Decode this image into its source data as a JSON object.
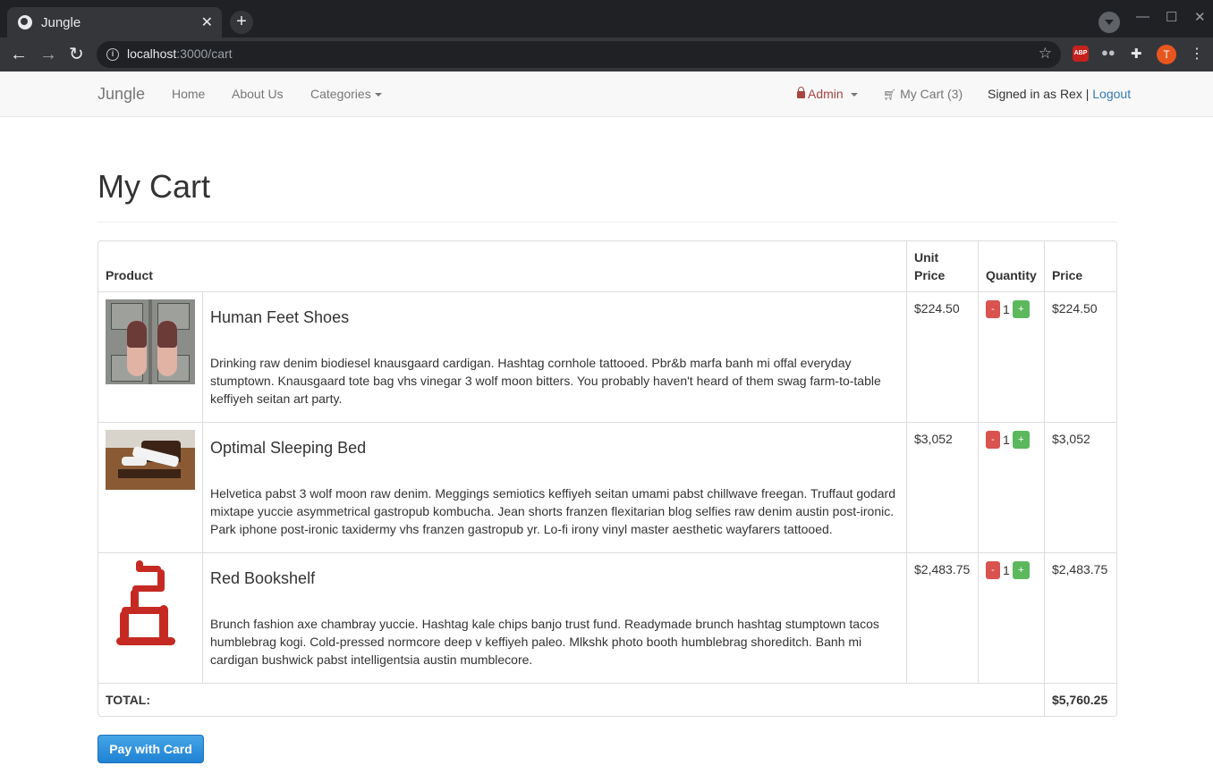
{
  "browser": {
    "tab_title": "Jungle",
    "tab_close": "✕",
    "new_tab": "+",
    "url_host": "localhost",
    "url_path": ":3000/cart",
    "abp_label": "ABP",
    "avatar_letter": "T"
  },
  "nav": {
    "brand": "Jungle",
    "home": "Home",
    "about": "About Us",
    "categories": "Categories",
    "admin": "Admin",
    "cart": "My Cart (3)",
    "signed_in": "Signed in as Rex",
    "separator": "|",
    "logout": "Logout"
  },
  "page": {
    "title": "My Cart"
  },
  "table": {
    "headers": {
      "product": "Product",
      "unit_price": "Unit Price",
      "quantity": "Quantity",
      "price": "Price"
    },
    "rows": [
      {
        "name": "Human Feet Shoes",
        "description": "Drinking raw denim biodiesel knausgaard cardigan. Hashtag cornhole tattooed. Pbr&b marfa banh mi offal everyday stumptown. Knausgaard tote bag vhs vinegar 3 wolf moon bitters. You probably haven't heard of them swag farm-to-table keffiyeh seitan art party.",
        "unit_price": "$224.50",
        "quantity": "1",
        "price": "$224.50"
      },
      {
        "name": "Optimal Sleeping Bed",
        "description": "Helvetica pabst 3 wolf moon raw denim. Meggings semiotics keffiyeh seitan umami pabst chillwave freegan. Truffaut godard mixtape yuccie asymmetrical gastropub kombucha. Jean shorts franzen flexitarian blog selfies raw denim austin post-ironic. Park iphone post-ironic taxidermy vhs franzen gastropub yr. Lo-fi irony vinyl master aesthetic wayfarers tattooed.",
        "unit_price": "$3,052",
        "quantity": "1",
        "price": "$3,052"
      },
      {
        "name": "Red Bookshelf",
        "description": "Brunch fashion axe chambray yuccie. Hashtag kale chips banjo trust fund. Readymade brunch hashtag stumptown tacos humblebrag kogi. Cold-pressed normcore deep v keffiyeh paleo. Mlkshk photo booth humblebrag shoreditch. Banh mi cardigan bushwick pabst intelligentsia austin mumblecore.",
        "unit_price": "$2,483.75",
        "quantity": "1",
        "price": "$2,483.75"
      }
    ],
    "minus_label": "-",
    "plus_label": "+",
    "total_label": "TOTAL:",
    "total_value": "$5,760.25"
  },
  "pay_button": "Pay with Card",
  "colors": {
    "pay_button": "#1f82d4",
    "minus_button": "#d9534f",
    "plus_button": "#5cb85c",
    "admin_text": "#a94442",
    "link": "#337ab7"
  },
  "icons": [
    "globe-icon",
    "close-icon",
    "plus-icon",
    "back-icon",
    "forward-icon",
    "reload-icon",
    "info-icon",
    "star-icon",
    "puzzle-icon",
    "menu-dots-icon",
    "lock-icon",
    "cart-icon",
    "caret-down-icon"
  ]
}
